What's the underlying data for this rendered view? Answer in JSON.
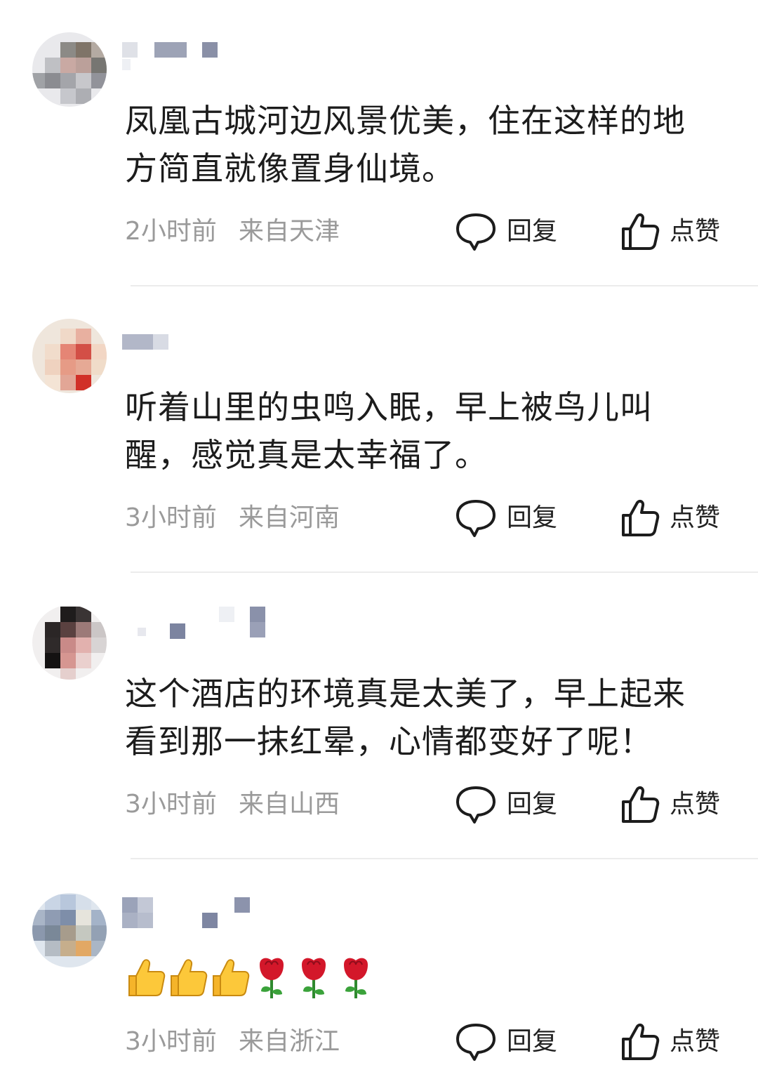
{
  "comments": [
    {
      "text": "凤凰古城河边风景优美，住在这样的地方简直就像置身仙境。",
      "time": "2小时前",
      "location": "来自天津",
      "reply_label": "回复",
      "like_label": "点赞"
    },
    {
      "text": "听着山里的虫鸣入眠，早上被鸟儿叫醒，感觉真是太幸福了。",
      "time": "3小时前",
      "location": "来自河南",
      "reply_label": "回复",
      "like_label": "点赞"
    },
    {
      "text": "这个酒店的环境真是太美了，早上起来看到那一抹红晕，心情都变好了呢！",
      "time": "3小时前",
      "location": "来自山西",
      "reply_label": "回复",
      "like_label": "点赞"
    },
    {
      "emojis": [
        "thumbs-up",
        "thumbs-up",
        "thumbs-up",
        "rose",
        "rose",
        "rose"
      ],
      "time": "3小时前",
      "location": "来自浙江",
      "reply_label": "回复",
      "like_label": "点赞"
    }
  ],
  "icons": {
    "reply": "speech-bubble-icon",
    "like": "thumbs-up-outline-icon"
  },
  "colors": {
    "text": "#1c1c1c",
    "meta": "#9a9a9a",
    "divider": "#ececec"
  }
}
